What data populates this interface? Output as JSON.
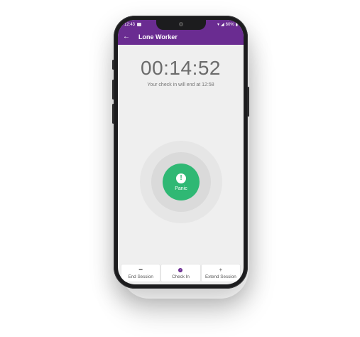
{
  "status_bar": {
    "time": "12:43",
    "battery": "60%"
  },
  "app_bar": {
    "back_icon": "arrow-left-icon",
    "title": "Lone Worker"
  },
  "timer": {
    "value": "00:14:52",
    "subtext": "Your check in will end at 12:58"
  },
  "panic": {
    "icon": "exclamation-icon",
    "label": "Panic"
  },
  "actions": [
    {
      "icon": "minus-icon",
      "label": "End Session"
    },
    {
      "icon": "check-circle-icon",
      "label": "Check In"
    },
    {
      "icon": "plus-icon",
      "label": "Extend Session"
    }
  ],
  "colors": {
    "primary": "#6a2c91",
    "panic": "#2fb874",
    "background": "#efefef"
  }
}
